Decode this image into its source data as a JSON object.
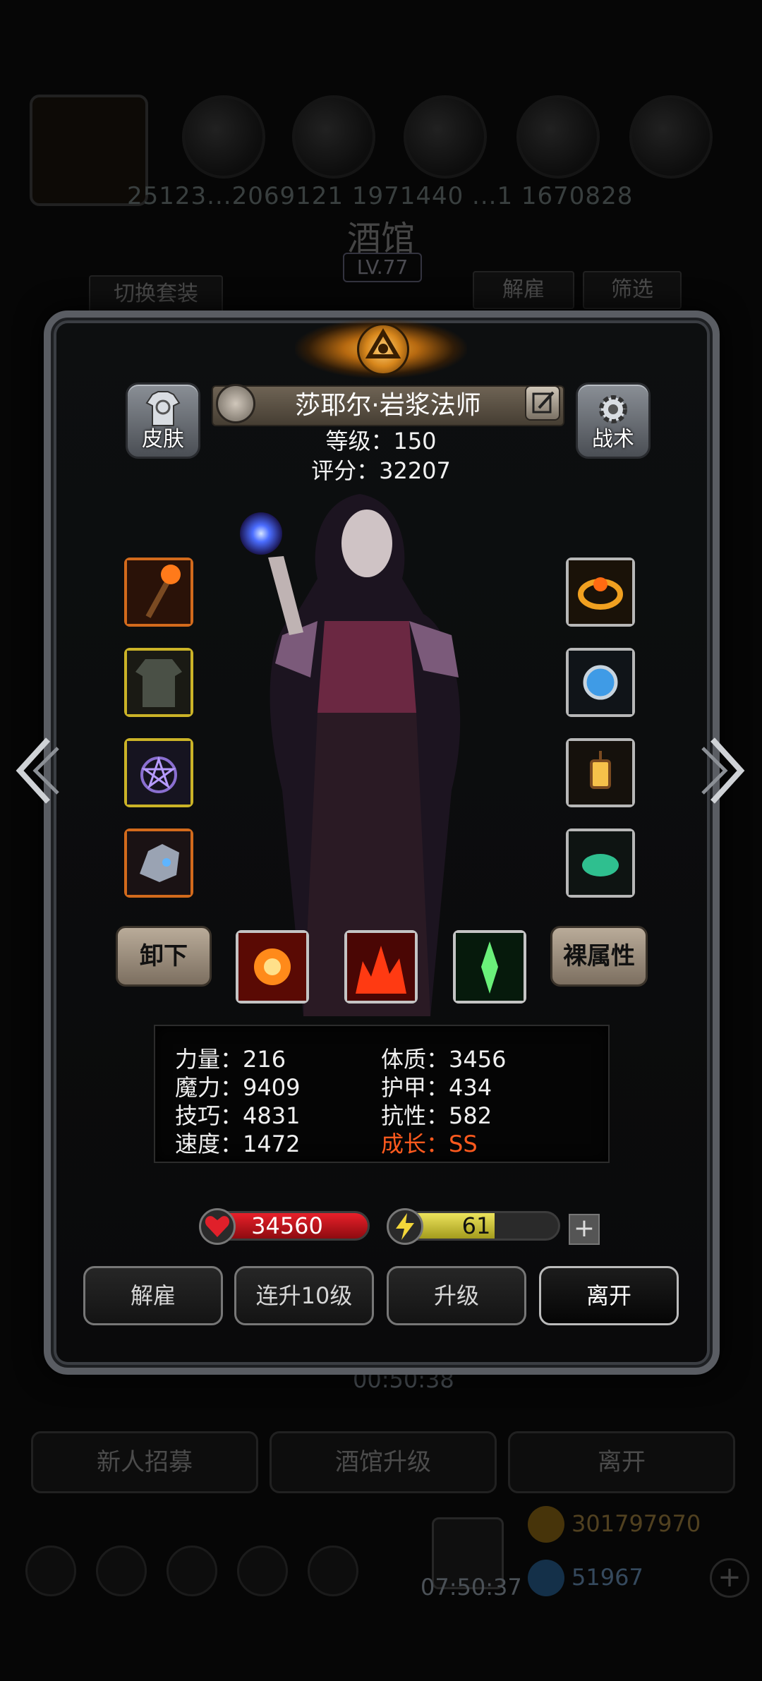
{
  "background": {
    "resources_text": "25123...2069121 1971440 ...1 1670828",
    "title": "酒馆",
    "level": "LV.77",
    "switch_outfit": "切换套装",
    "dismiss": "解雇",
    "filter": "筛选",
    "timer1": "00:50:38",
    "recruit": "新人招募",
    "tavern_upgrade": "酒馆升级",
    "leave": "离开",
    "gold": "301797970",
    "gems": "51967",
    "timer2": "07:50:37"
  },
  "hero": {
    "name": "莎耶尔·岩浆法师",
    "level_line": "等级：150",
    "score_line": "评分：32207",
    "skin_label": "皮肤",
    "tactics_label": "战术"
  },
  "equipment_left": [
    "fire-staff-icon",
    "robe-armor-icon",
    "pentagram-amulet-icon",
    "dragon-helm-icon"
  ],
  "equipment_right": [
    "flame-ring-icon",
    "blue-orb-icon",
    "lantern-icon",
    "jade-stone-icon"
  ],
  "actions": {
    "unequip": "卸下",
    "base_stats": "裸属性"
  },
  "skills": [
    "fire-burst-icon",
    "flame-wall-icon",
    "green-crystal-icon"
  ],
  "stats": {
    "strength": "力量：216",
    "magic": "魔力：9409",
    "skill": "技巧：4831",
    "speed": "速度：1472",
    "constitution": "体质：3456",
    "armor": "护甲：434",
    "resistance": "抗性：582",
    "growth": "成长：SS"
  },
  "vitals": {
    "hp": "34560",
    "energy": "61",
    "energy_fraction": 0.61,
    "plus": "+"
  },
  "bottom": {
    "dismiss": "解雇",
    "level10": "连升10级",
    "upgrade": "升级",
    "leave": "离开"
  },
  "colors": {
    "growth_highlight": "#ff5a1e",
    "hp": "#d41820",
    "energy": "#d8cf3c"
  }
}
